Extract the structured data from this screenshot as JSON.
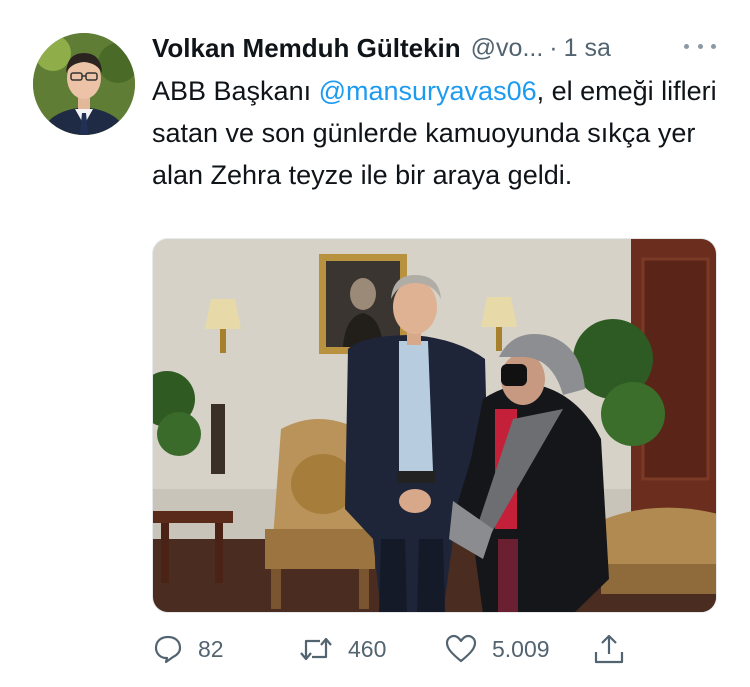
{
  "tweet": {
    "author_name": "Volkan Memduh Gültekin",
    "author_handle": "@vo...",
    "separator": "·",
    "time": "1 sa",
    "text_prefix": "ABB Başkanı ",
    "mention": "@mansuryavas06",
    "text_suffix": ", el emeği lifleri satan ve son günlerde kamuoyunda sıkça yer alan Zehra teyze ile bir araya geldi."
  },
  "actions": {
    "replies": "82",
    "retweets": "460",
    "likes": "5.009"
  },
  "icons": {
    "reply": "speech-bubble-icon",
    "retweet": "retweet-icon",
    "like": "heart-icon",
    "share": "share-icon",
    "more": "more-dots-icon"
  },
  "colors": {
    "mention": "#1d9bf0",
    "secondary_text": "#536471",
    "primary_text": "#0f1419"
  }
}
